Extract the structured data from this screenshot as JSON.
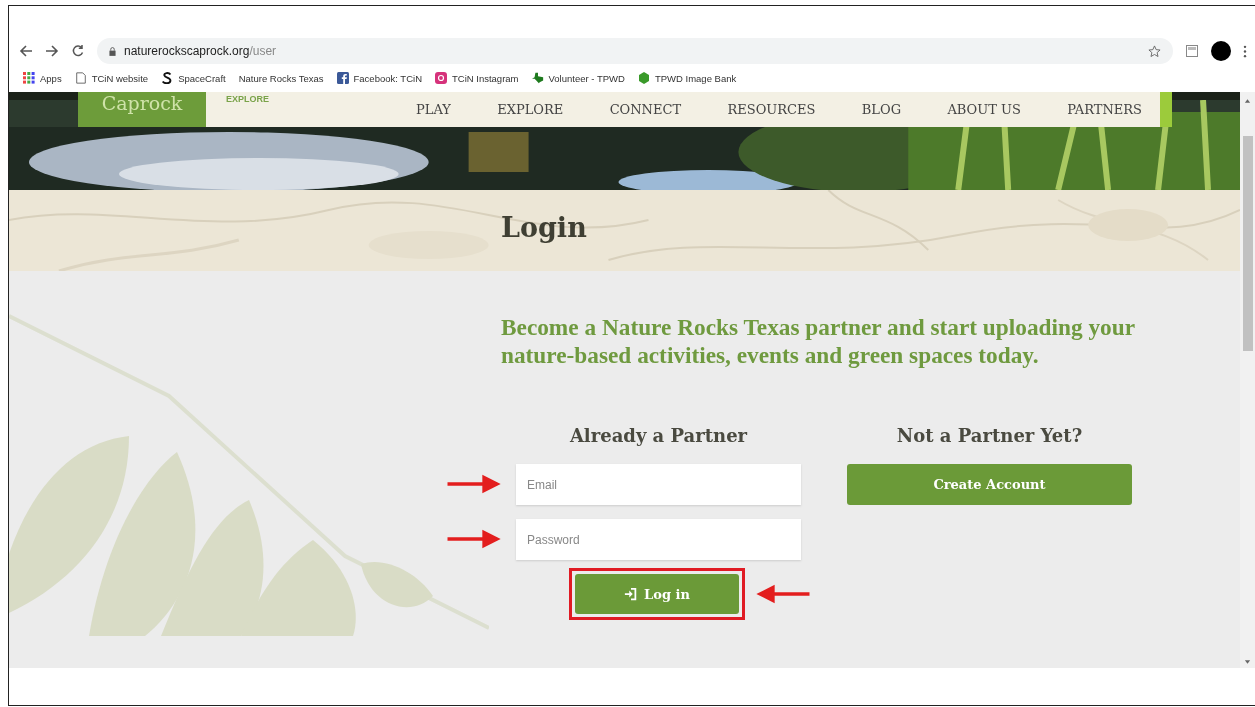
{
  "browser": {
    "url_host": "naturerockscaprock.org",
    "url_path": "/user",
    "bookmarks": [
      {
        "kind": "apps",
        "label": "Apps"
      },
      {
        "kind": "page",
        "label": "TCiN website"
      },
      {
        "kind": "s",
        "label": "SpaceCraft"
      },
      {
        "kind": "none",
        "label": "Nature Rocks Texas"
      },
      {
        "kind": "facebook",
        "label": "Facebook: TCiN"
      },
      {
        "kind": "instagram",
        "label": "TCiN Instagram"
      },
      {
        "kind": "texas",
        "label": "Volunteer - TPWD"
      },
      {
        "kind": "hex",
        "label": "TPWD Image Bank"
      }
    ]
  },
  "site": {
    "logo_text": "Caprock",
    "logo_tagline": "EXPLORE",
    "nav": [
      "PLAY",
      "EXPLORE",
      "CONNECT",
      "RESOURCES",
      "BLOG",
      "ABOUT US",
      "PARTNERS"
    ]
  },
  "page_title": "Login",
  "intro": "Become a Nature Rocks Texas partner and start uploading your nature-based activities, events and green spaces today.",
  "login": {
    "heading": "Already a Partner",
    "email_placeholder": "Email",
    "password_placeholder": "Password",
    "button": "Log in"
  },
  "signup": {
    "heading": "Not a Partner Yet?",
    "button": "Create Account"
  }
}
